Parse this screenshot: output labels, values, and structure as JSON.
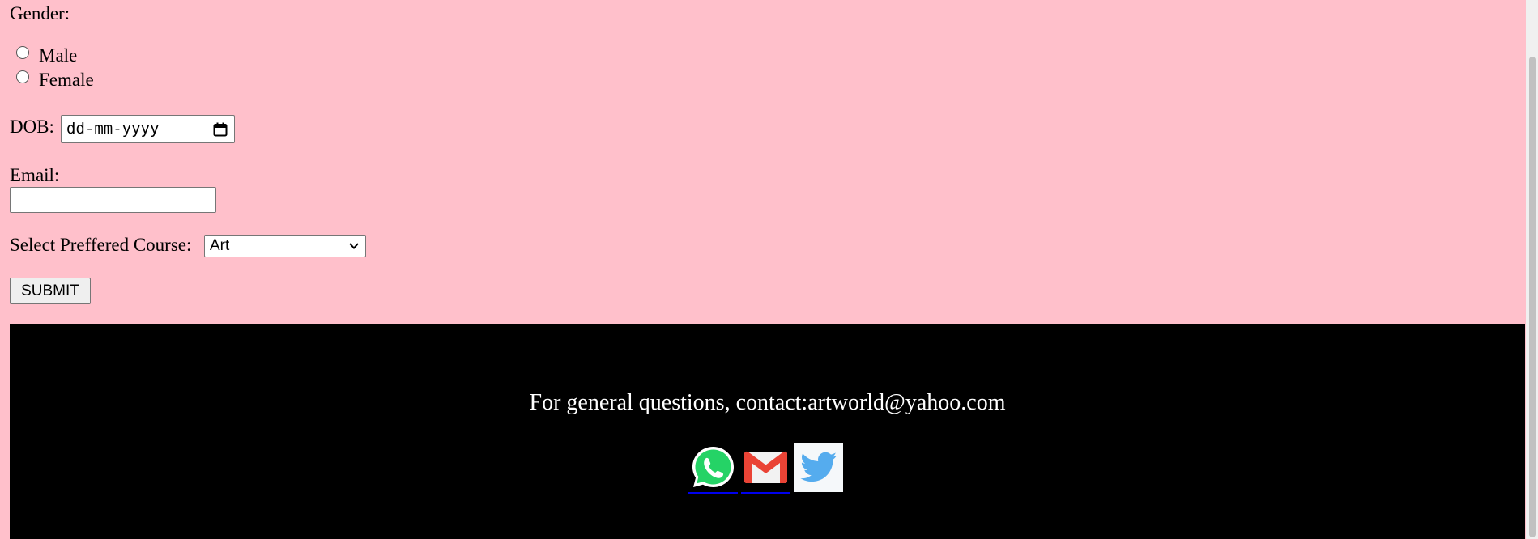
{
  "form": {
    "gender_label": "Gender:",
    "gender_options": [
      "Male",
      "Female"
    ],
    "dob_label": "DOB:",
    "dob_placeholder": "dd-mm-yyyy",
    "email_label": "Email:",
    "email_value": "",
    "course_label": "Select Preffered Course:",
    "course_selected": "Art",
    "submit_label": "SUBMIT"
  },
  "footer": {
    "contact_text": "For general questions, contact:artworld@yahoo.com",
    "social_icons": [
      "whatsapp-icon",
      "gmail-icon",
      "twitter-icon"
    ]
  },
  "colors": {
    "page_bg": "#ffc0cb",
    "footer_bg": "#000000",
    "footer_text": "#ffffff",
    "whatsapp": "#25d366",
    "gmail_red": "#ea4335",
    "twitter": "#55acee"
  }
}
